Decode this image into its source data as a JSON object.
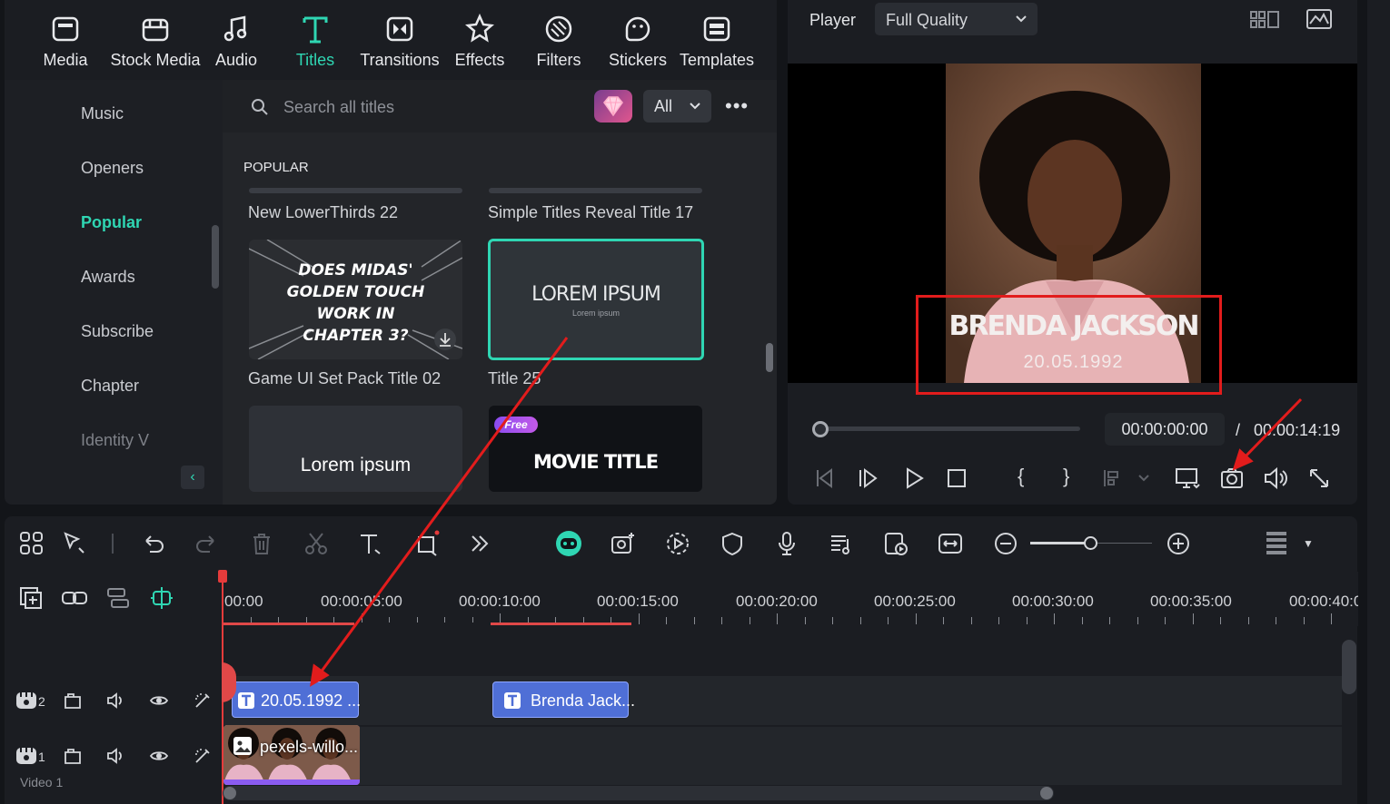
{
  "topbar": {
    "tabs": [
      {
        "label": "Media",
        "icon": "media-icon"
      },
      {
        "label": "Stock Media",
        "icon": "stock-media-icon"
      },
      {
        "label": "Audio",
        "icon": "audio-icon"
      },
      {
        "label": "Titles",
        "icon": "titles-icon",
        "active": true
      },
      {
        "label": "Transitions",
        "icon": "transitions-icon"
      },
      {
        "label": "Effects",
        "icon": "effects-icon"
      },
      {
        "label": "Filters",
        "icon": "filters-icon"
      },
      {
        "label": "Stickers",
        "icon": "stickers-icon"
      },
      {
        "label": "Templates",
        "icon": "templates-icon"
      }
    ]
  },
  "categories": [
    "Music",
    "Openers",
    "Popular",
    "Awards",
    "Subscribe",
    "Chapter",
    "Identity V"
  ],
  "active_category": "Popular",
  "search": {
    "placeholder": "Search all titles",
    "filter": "All"
  },
  "section_heading": "POPULAR",
  "titles": [
    {
      "label": "New LowerThirds 22"
    },
    {
      "label": "Simple Titles Reveal Title 17"
    },
    {
      "label": "Game UI Set Pack Title 02",
      "thumb_text": "DOES MIDAS' GOLDEN TOUCH WORK IN CHAPTER 3?"
    },
    {
      "label": "Title 25",
      "thumb_text": "LOREM IPSUM",
      "thumb_sub": "Lorem ipsum",
      "selected": true
    },
    {
      "label": "",
      "thumb_text": "Lorem ipsum"
    },
    {
      "label": "",
      "thumb_text": "MOVIE TITLE",
      "badge": "Free"
    }
  ],
  "player": {
    "label": "Player",
    "quality": "Full Quality",
    "overlay_title": "BRENDA JACKSON",
    "overlay_sub": "20.05.1992",
    "current_time": "00:00:00:00",
    "separator": "/",
    "total_time": "00:00:14:19"
  },
  "timeline": {
    "ruler": [
      "00:00",
      "00:00:05:00",
      "00:00:10:00",
      "00:00:15:00",
      "00:00:20:00",
      "00:00:25:00",
      "00:00:30:00",
      "00:00:35:00",
      "00:00:40:0"
    ],
    "tracks": [
      {
        "number": "2",
        "clips": [
          {
            "label": "20.05.1992 ..."
          },
          {
            "label": "Brenda Jack..."
          }
        ]
      },
      {
        "number": "1",
        "name": "Video 1",
        "clips": [
          {
            "label": "pexels-willo..."
          }
        ]
      }
    ]
  },
  "colors": {
    "accent": "#2fd6b3",
    "clip_title": "#4f6fd6",
    "annotation": "#e21c1c"
  }
}
